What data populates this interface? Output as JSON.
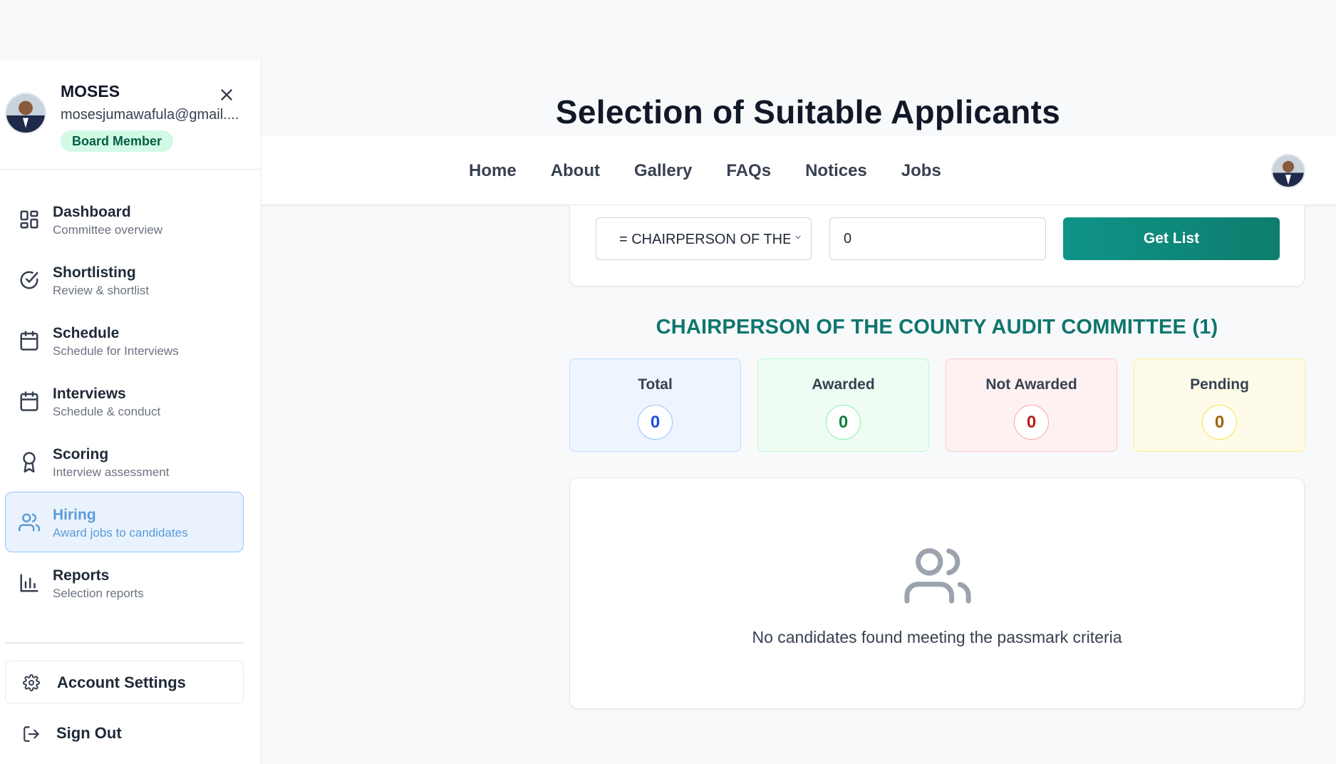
{
  "page_title": "Selection of Suitable Applicants",
  "navbar": {
    "links": [
      "Home",
      "About",
      "Gallery",
      "FAQs",
      "Notices",
      "Jobs"
    ]
  },
  "sidebar": {
    "profile": {
      "name": "MOSES",
      "email": "mosesjumawafula@gmail....",
      "role": "Board Member"
    },
    "items": [
      {
        "label": "Dashboard",
        "sub": "Committee overview",
        "icon": "dashboard-icon"
      },
      {
        "label": "Shortlisting",
        "sub": "Review & shortlist",
        "icon": "check-circle-icon"
      },
      {
        "label": "Schedule",
        "sub": "Schedule for Interviews",
        "icon": "calendar-icon"
      },
      {
        "label": "Interviews",
        "sub": "Schedule & conduct",
        "icon": "calendar-icon"
      },
      {
        "label": "Scoring",
        "sub": "Interview assessment",
        "icon": "award-icon"
      },
      {
        "label": "Hiring",
        "sub": "Award jobs to candidates",
        "icon": "users-icon",
        "active": true
      },
      {
        "label": "Reports",
        "sub": "Selection reports",
        "icon": "bar-chart-icon"
      }
    ],
    "account_settings": "Account Settings",
    "sign_out": "Sign Out"
  },
  "filter": {
    "position_selected": "= CHAIRPERSON OF THE...",
    "passmark_value": "0",
    "get_list_label": "Get List"
  },
  "position_heading": "CHAIRPERSON OF THE COUNTY AUDIT COMMITTEE (1)",
  "stats": {
    "total": {
      "label": "Total",
      "value": "0"
    },
    "awarded": {
      "label": "Awarded",
      "value": "0"
    },
    "not_awarded": {
      "label": "Not Awarded",
      "value": "0"
    },
    "pending": {
      "label": "Pending",
      "value": "0"
    }
  },
  "empty_state": {
    "message": "No candidates found meeting the passmark criteria"
  },
  "colors": {
    "accent": "#0f766e",
    "active_menu": "#5b9bd8",
    "primary_button": "#0f9488"
  }
}
